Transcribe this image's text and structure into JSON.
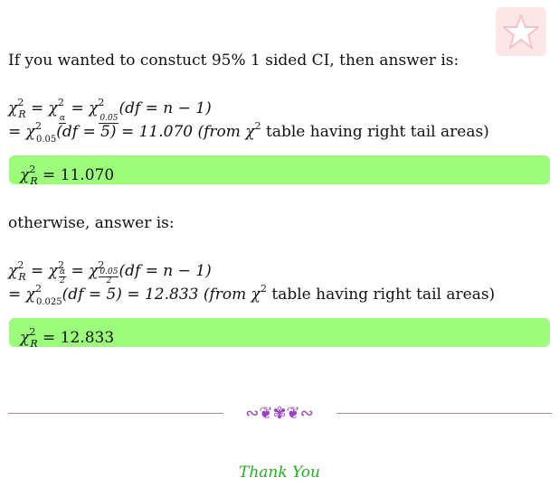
{
  "intro_text": "If you wanted to constuct 95% 1 sided CI, then answer is:",
  "one_sided": {
    "lhs_base": "χ",
    "lhs_sup": "2",
    "lhs_sub": "R",
    "alpha_sub": "α",
    "alpha_val_sub": "0.05",
    "df_expr": "(df = n − 1)",
    "line2_sub": "0.05",
    "line2_df": "(df = 5) = 11.070 (from",
    "table_note": "table having right tail areas)",
    "result_value": "= 11.070"
  },
  "otherwise_text": "otherwise, answer is:",
  "two_sided": {
    "alpha_num": "α",
    "alpha_den": "2",
    "alpha_val_num": "0.05",
    "alpha_val_den": "2",
    "df_expr": "(df = n − 1)",
    "line2_sub": "0.025",
    "line2_df": "(df = 5) = 12.833 (from",
    "table_note": "table having right tail areas)",
    "result_value": "= 12.833"
  },
  "thanks_text": "Thank You",
  "colors": {
    "result_bg": "#9cfc7c",
    "divider": "#b57bd4",
    "ornament": "#9b3fc6",
    "thanks": "#22b022",
    "logo_bg": "#fde6e8"
  },
  "icons": {
    "logo": "star-badge-icon",
    "ornament": "flourish-ornament-icon"
  }
}
